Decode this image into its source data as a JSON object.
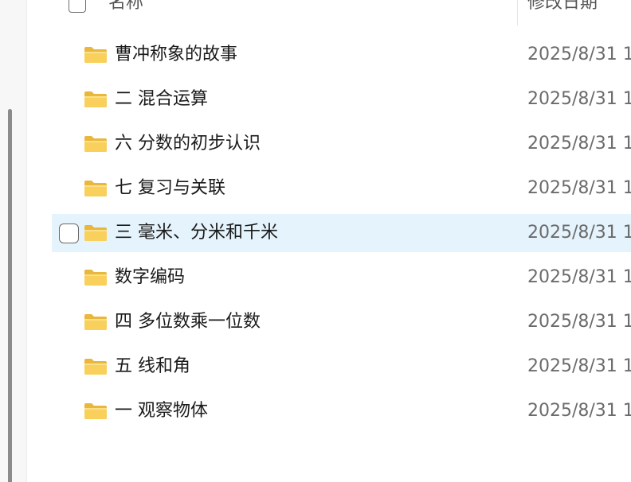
{
  "header": {
    "name_label": "名称",
    "date_label": "修改日期"
  },
  "rows": [
    {
      "name": "曹冲称象的故事",
      "date": "2025/8/31 1"
    },
    {
      "name": "二 混合运算",
      "date": "2025/8/31 1"
    },
    {
      "name": "六 分数的初步认识",
      "date": "2025/8/31 1"
    },
    {
      "name": "七 复习与关联",
      "date": "2025/8/31 1"
    },
    {
      "name": "三 毫米、分米和千米",
      "date": "2025/8/31 1"
    },
    {
      "name": "数字编码",
      "date": "2025/8/31 1"
    },
    {
      "name": "四 多位数乘一位数",
      "date": "2025/8/31 1"
    },
    {
      "name": "五 线和角",
      "date": "2025/8/31 1"
    },
    {
      "name": "一 观察物体",
      "date": "2025/8/31 1"
    }
  ],
  "selected_row": "三 毫米、分米和千米",
  "icons": {
    "folder": "folder-icon",
    "checkbox": "checkbox"
  },
  "colors": {
    "selection_bg": "#e5f3fc",
    "folder_yellow": "#f8d05b",
    "date_text": "#6b6b6b"
  }
}
